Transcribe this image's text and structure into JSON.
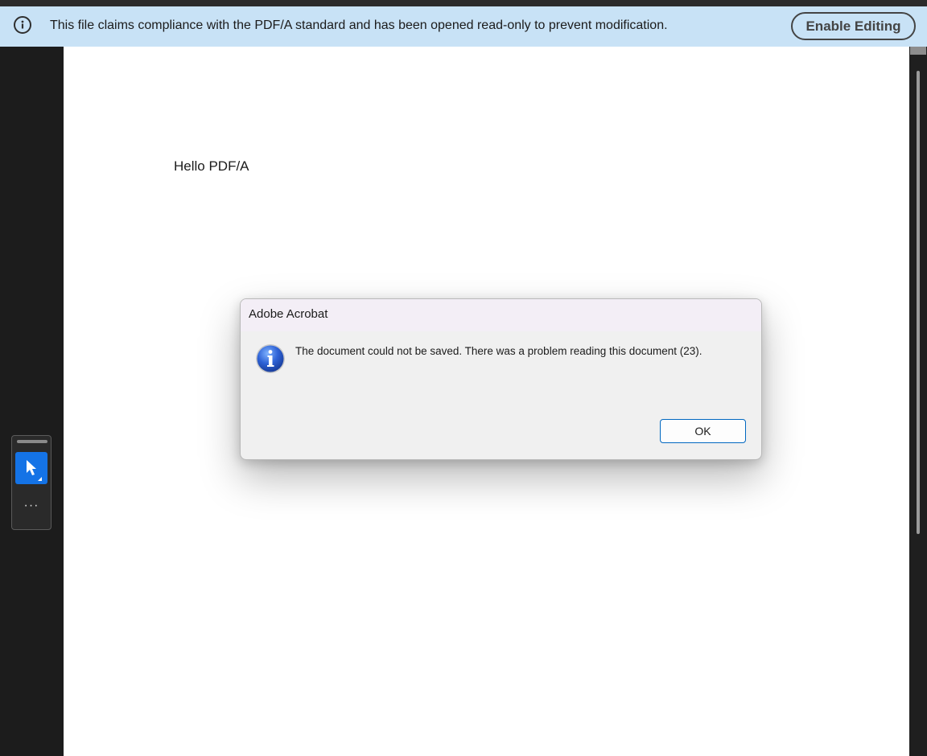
{
  "infobar": {
    "message": "This file claims compliance with the PDF/A standard and has been opened read-only to prevent modification.",
    "enable_editing_label": "Enable Editing",
    "icon": "info-circle-icon"
  },
  "tool_palette": {
    "select_tool_icon": "cursor-arrow-icon",
    "more_tools_label": "···"
  },
  "document": {
    "body_text": "Hello PDF/A"
  },
  "dialog": {
    "title": "Adobe Acrobat",
    "message": "The document could not be saved. There was a problem reading this document (23).",
    "icon": "information-icon",
    "ok_label": "OK"
  },
  "colors": {
    "infobar_bg": "#c8e2f6",
    "accent": "#1473e6",
    "dialog_bg": "#f0f0f0"
  }
}
